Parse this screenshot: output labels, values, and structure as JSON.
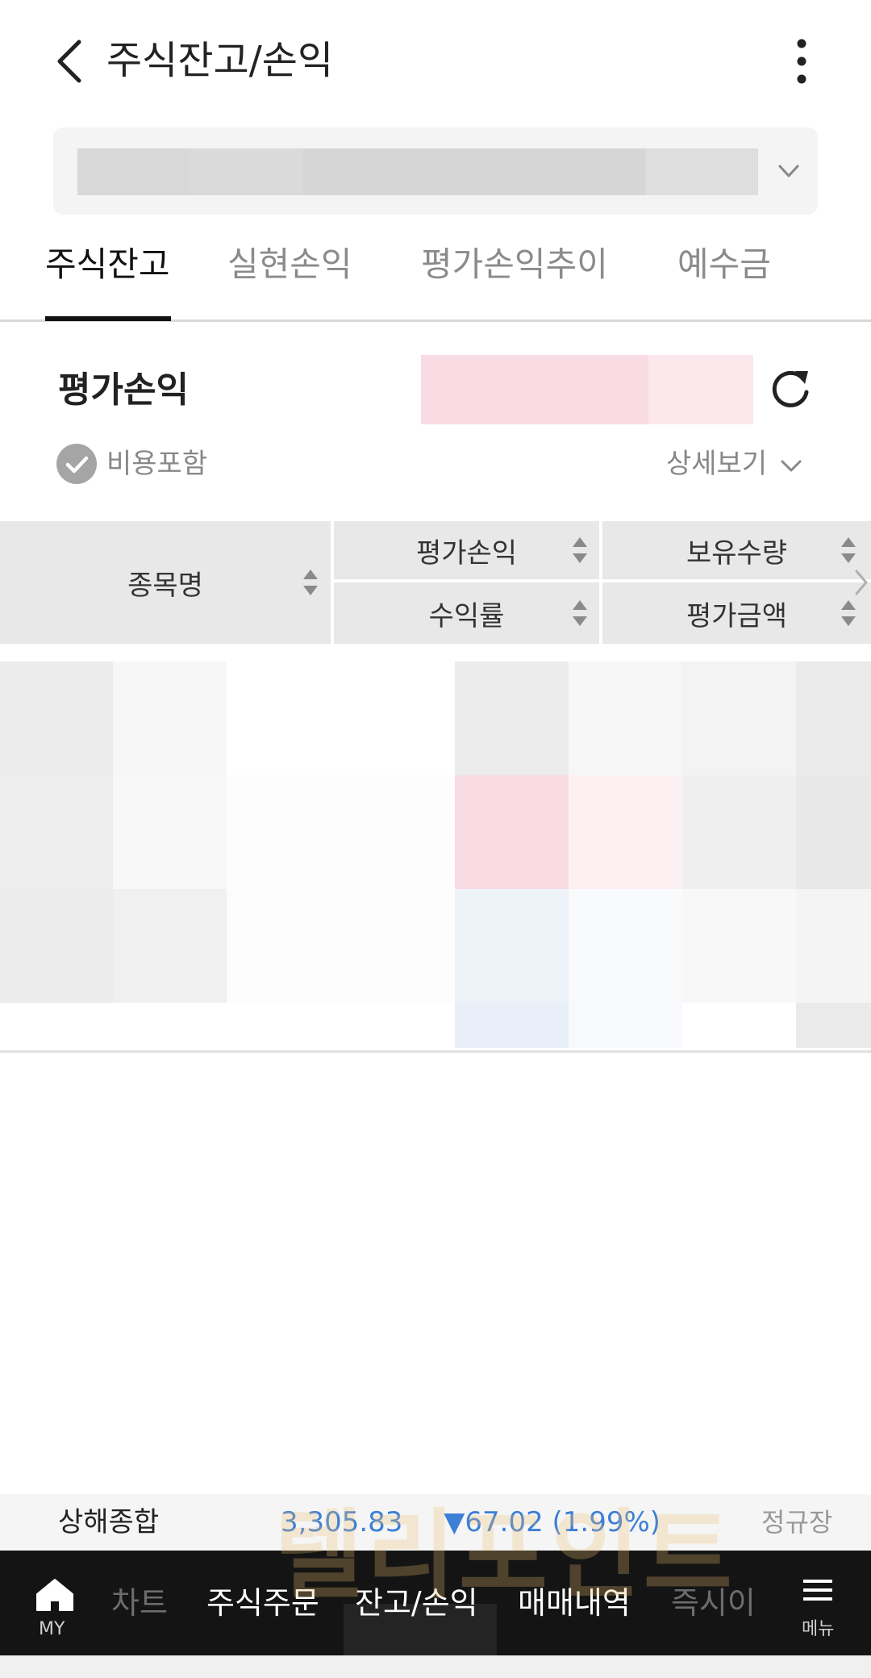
{
  "header": {
    "title": "주식잔고/손익",
    "back_icon": "chevron-left-icon",
    "more_icon": "more-vertical-icon"
  },
  "account_selector": {
    "value": "",
    "dropdown_icon": "chevron-down-icon"
  },
  "tabs": [
    {
      "label": "주식잔고",
      "active": true
    },
    {
      "label": "실현손익",
      "active": false
    },
    {
      "label": "평가손익추이",
      "active": false
    },
    {
      "label": "예수금",
      "active": false
    }
  ],
  "summary": {
    "eval_label": "평가손익",
    "refresh_icon": "refresh-icon",
    "fee_included_label": "비용포함",
    "fee_included_checked": true,
    "detail_label": "상세보기"
  },
  "table": {
    "headers": {
      "name": "종목명",
      "eval_pl": "평가손익",
      "return_rate": "수익률",
      "quantity": "보유수량",
      "eval_amount": "평가금액"
    },
    "scroll_right_icon": "chevron-right-icon"
  },
  "ticker": {
    "index_name": "상해종합",
    "index_value": "3,305.83",
    "change": "▼67.02 (1.99%)",
    "market_status": "정규장",
    "change_color": "#3c7fd6"
  },
  "watermark": "텔리포인트",
  "bottom_nav": {
    "my_label": "MY",
    "items": [
      "차트",
      "주식주문",
      "잔고/손익",
      "매매내역",
      "즉시이"
    ],
    "menu_label": "메뉴",
    "home_icon": "home-icon",
    "menu_icon": "hamburger-menu-icon"
  }
}
